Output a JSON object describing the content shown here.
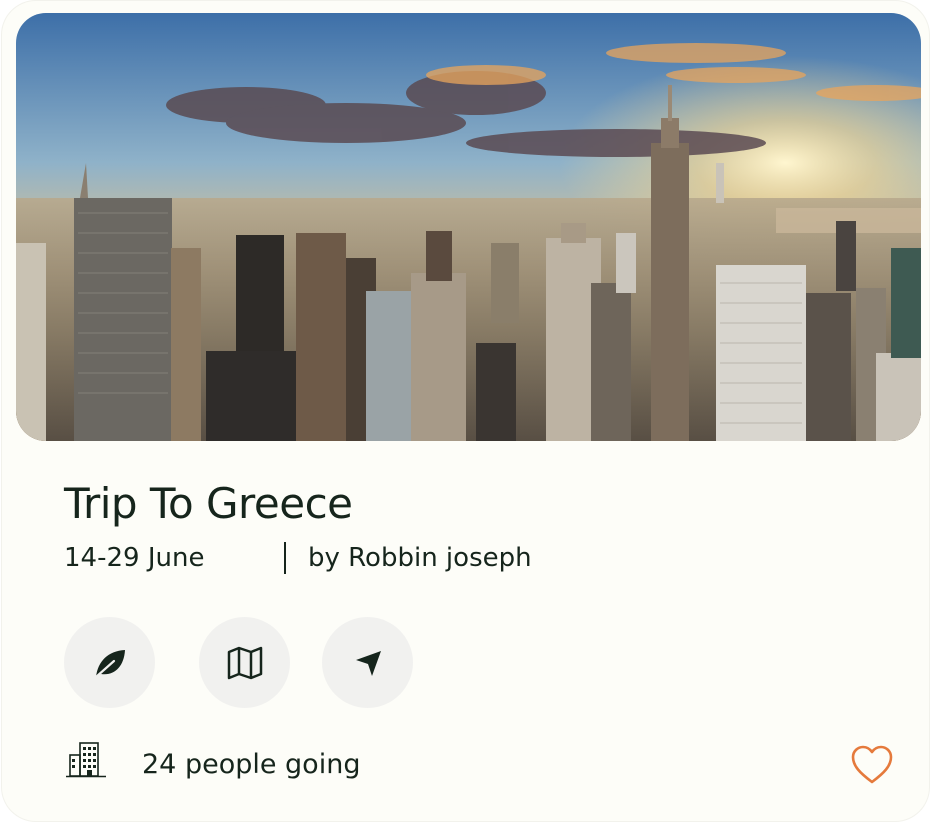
{
  "trip": {
    "title": "Trip To Greece",
    "dates": "14-29 June",
    "author": "by Robbin joseph",
    "people_going": "24 people going",
    "favorite": false
  },
  "hero_image": {
    "description_icon": "city-skyline-photo"
  },
  "actions": [
    {
      "icon": "leaf-icon"
    },
    {
      "icon": "map-icon"
    },
    {
      "icon": "send-icon"
    }
  ],
  "colors": {
    "card_bg": "#fdfdf8",
    "text": "#16251c",
    "button_bg": "#f1f1ef",
    "heart": "#e57a3c"
  }
}
